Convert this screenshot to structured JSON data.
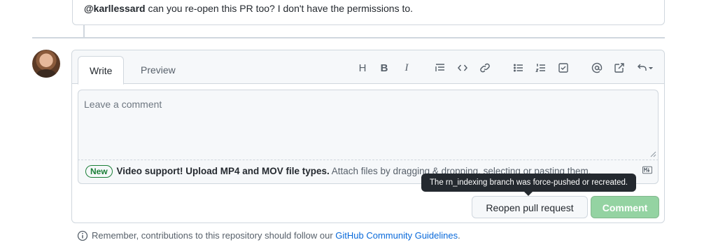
{
  "previous_comment": {
    "mention": "@karllessard",
    "text": " can you re-open this PR too? I don't have the permissions to."
  },
  "composer": {
    "tabs": [
      {
        "label": "Write",
        "active": true
      },
      {
        "label": "Preview",
        "active": false
      }
    ],
    "toolbar": {
      "heading_glyph": "H",
      "bold_glyph": "B",
      "italic_glyph": "I",
      "icons": [
        "heading-icon",
        "bold-icon",
        "italic-icon",
        "quote-icon",
        "code-icon",
        "link-icon",
        "bulleted-list-icon",
        "numbered-list-icon",
        "task-list-icon",
        "mention-icon",
        "cross-reference-icon",
        "saved-replies-icon"
      ]
    },
    "textarea": {
      "placeholder": "Leave a comment"
    },
    "attach": {
      "badge": "New",
      "strong": "Video support! Upload MP4 and MOV file types.",
      "text": " Attach files by dragging & dropping, selecting or pasting them."
    }
  },
  "actions": {
    "reopen_label": "Reopen pull request",
    "comment_label": "Comment"
  },
  "tooltip": {
    "text": "The rn_indexing branch was force-pushed or recreated."
  },
  "footer": {
    "prefix": "Remember, contributions to this repository should follow our ",
    "link": "GitHub Community Guidelines",
    "suffix": "."
  },
  "colors": {
    "accent_green": "#1a7f37",
    "comment_button_disabled": "#94d3a2",
    "link_blue": "#0969da",
    "tooltip_bg": "#24292f"
  }
}
